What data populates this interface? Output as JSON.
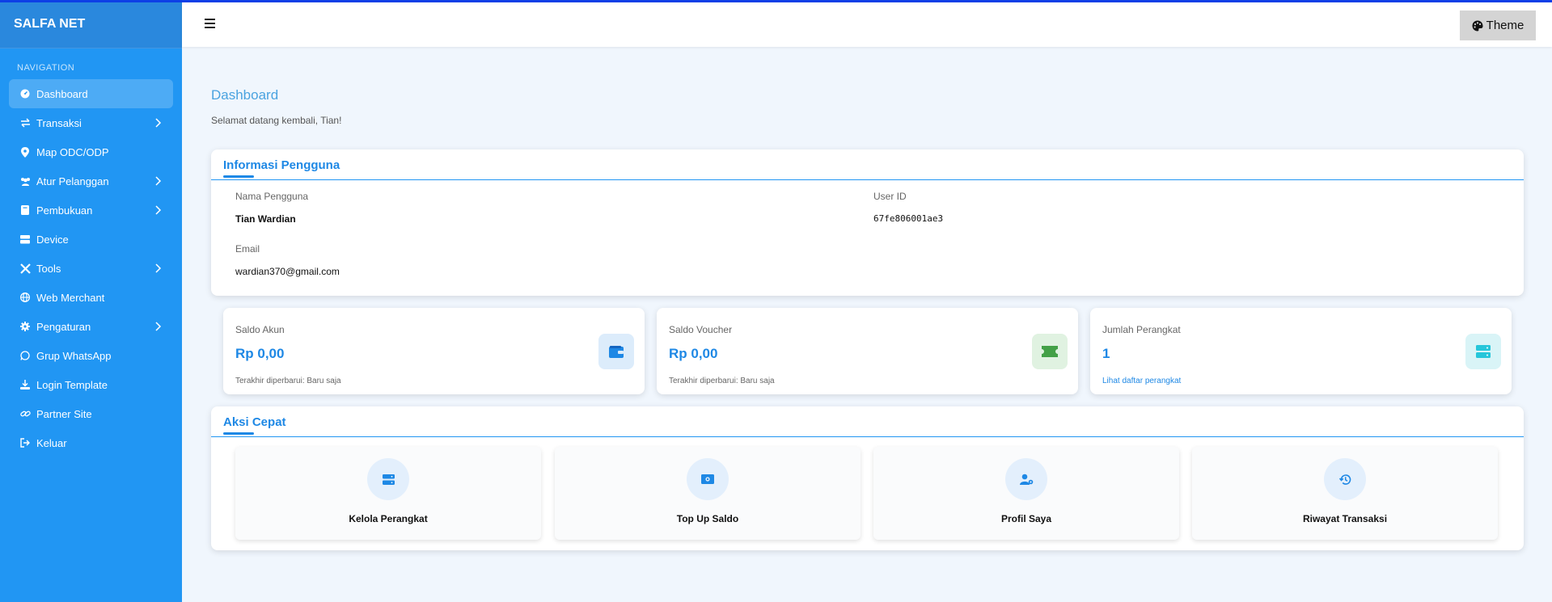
{
  "brand": "SALFA NET",
  "nav": {
    "section_label": "NAVIGATION",
    "items": [
      {
        "label": "Dashboard",
        "icon": "dashboard-icon",
        "active": true,
        "submenu": false
      },
      {
        "label": "Transaksi",
        "icon": "exchange-icon",
        "submenu": true
      },
      {
        "label": "Map ODC/ODP",
        "icon": "map-pin-icon",
        "submenu": false
      },
      {
        "label": "Atur Pelanggan",
        "icon": "users-icon",
        "submenu": true
      },
      {
        "label": "Pembukuan",
        "icon": "book-icon",
        "submenu": true
      },
      {
        "label": "Device",
        "icon": "server-icon",
        "submenu": false
      },
      {
        "label": "Tools",
        "icon": "tools-icon",
        "submenu": true
      },
      {
        "label": "Web Merchant",
        "icon": "globe-icon",
        "submenu": false
      },
      {
        "label": "Pengaturan",
        "icon": "gear-icon",
        "submenu": true
      },
      {
        "label": "Grup WhatsApp",
        "icon": "whatsapp-icon",
        "submenu": false
      },
      {
        "label": "Login Template",
        "icon": "download-icon",
        "submenu": false
      },
      {
        "label": "Partner Site",
        "icon": "link-icon",
        "submenu": false
      },
      {
        "label": "Keluar",
        "icon": "logout-icon",
        "submenu": false
      }
    ]
  },
  "topbar": {
    "menu_icon": "hamburger-icon",
    "theme_label": "Theme"
  },
  "page": {
    "title": "Dashboard",
    "subtitle": "Selamat datang kembali, Tian!"
  },
  "user_info": {
    "heading": "Informasi Pengguna",
    "name_label": "Nama Pengguna",
    "name_value": "Tian Wardian",
    "userid_label": "User ID",
    "userid_value": "67fe806001ae3",
    "email_label": "Email",
    "email_value": "wardian370@gmail.com"
  },
  "stats": [
    {
      "label": "Saldo Akun",
      "value": "Rp 0,00",
      "footer": "Terakhir diperbarui: Baru saja",
      "icon": "wallet-icon",
      "color": "#1e88e5"
    },
    {
      "label": "Saldo Voucher",
      "value": "Rp 0,00",
      "footer": "Terakhir diperbarui: Baru saja",
      "icon": "ticket-icon",
      "color": "#43a047"
    },
    {
      "label": "Jumlah Perangkat",
      "value": "1",
      "footer": "Lihat daftar perangkat",
      "icon": "server-icon",
      "color": "#26c6da"
    }
  ],
  "quick_actions": {
    "heading": "Aksi Cepat",
    "items": [
      {
        "label": "Kelola Perangkat",
        "icon": "server-icon"
      },
      {
        "label": "Top Up Saldo",
        "icon": "money-icon"
      },
      {
        "label": "Profil Saya",
        "icon": "user-cog-icon"
      },
      {
        "label": "Riwayat Transaksi",
        "icon": "history-icon"
      }
    ]
  }
}
